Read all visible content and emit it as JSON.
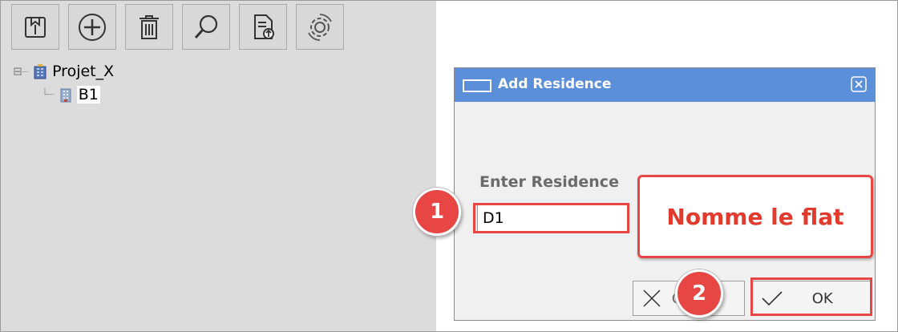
{
  "toolbar": {
    "buttons": [
      {
        "icon": "import-icon"
      },
      {
        "icon": "add-circle-icon"
      },
      {
        "icon": "trash-icon"
      },
      {
        "icon": "search-icon"
      },
      {
        "icon": "export-file-icon"
      },
      {
        "icon": "settings-gear-icon"
      }
    ]
  },
  "tree": {
    "project_label": "Projet_X",
    "child_label": "B1",
    "expander": "⊟"
  },
  "dialog": {
    "title": "Add Residence",
    "field_label": "Enter Residence",
    "input_value": "D1",
    "cancel_label": "C",
    "ok_label": "OK"
  },
  "annotations": {
    "step1": "1",
    "step2": "2",
    "callout_text": "Nomme le flat"
  },
  "colors": {
    "title_bar": "#5b8fd9",
    "highlight_red": "#e84545",
    "callout_text": "#e23b2e",
    "tree_background": "#dcdcdc"
  }
}
